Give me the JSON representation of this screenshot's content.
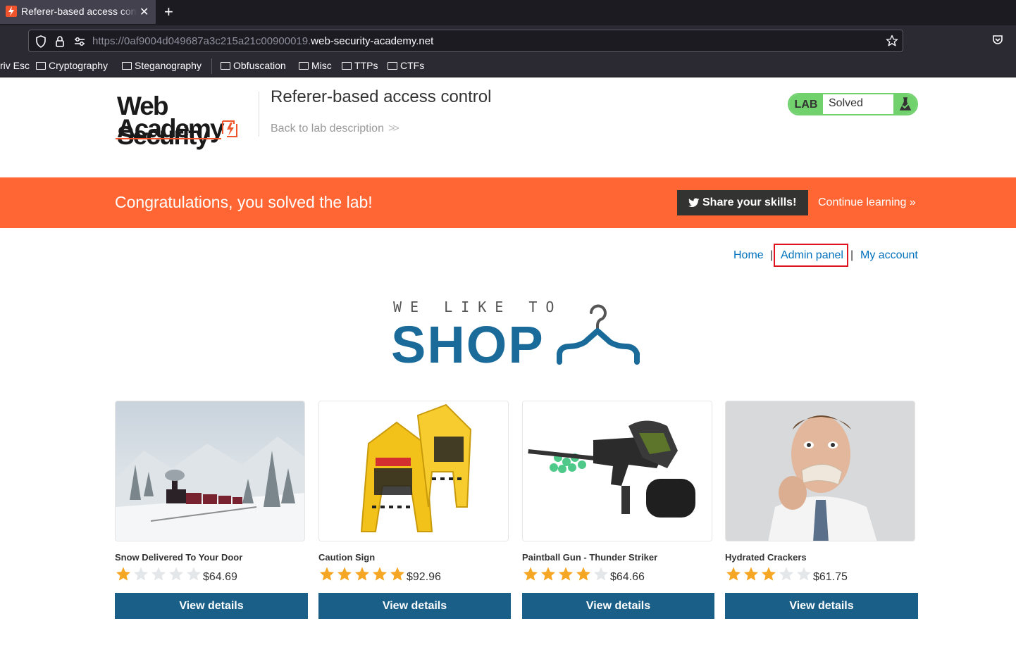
{
  "browser": {
    "tab_title": "Referer-based access control",
    "url_prefix": "https://0af9004d049687a3c215a21c00900019.",
    "url_domain": "web-security-academy.net",
    "bookmarks": [
      "riv Esc",
      "Cryptography",
      "Steganography",
      "Obfuscation",
      "Misc",
      "TTPs",
      "CTFs"
    ]
  },
  "header": {
    "logo_line1": "Web Security",
    "logo_line2": "Academy",
    "lab_title": "Referer-based access control",
    "back_link": "Back to lab description",
    "lab_label": "LAB",
    "lab_status": "Solved"
  },
  "banner": {
    "message": "Congratulations, you solved the lab!",
    "share_label": "Share your skills!",
    "continue_label": "Continue learning »"
  },
  "nav": {
    "home": "Home",
    "admin_panel": "Admin panel",
    "my_account": "My account",
    "separator": "|"
  },
  "shop_logo": {
    "tagline": "WE LIKE TO",
    "word": "SHOP"
  },
  "products": [
    {
      "name": "Snow Delivered To Your Door",
      "rating": 1,
      "price": "$64.69",
      "button": "View details"
    },
    {
      "name": "Caution Sign",
      "rating": 5,
      "price": "$92.96",
      "button": "View details"
    },
    {
      "name": "Paintball Gun - Thunder Striker",
      "rating": 4,
      "price": "$64.66",
      "button": "View details"
    },
    {
      "name": "Hydrated Crackers",
      "rating": 3,
      "price": "$61.75",
      "button": "View details"
    }
  ],
  "colors": {
    "accent_orange": "#ff6633",
    "button_blue": "#1a5f88",
    "link_blue": "#0071bc",
    "lab_green": "#70d16d",
    "star_gold": "#f5a623",
    "highlight_red": "#e0141e"
  }
}
